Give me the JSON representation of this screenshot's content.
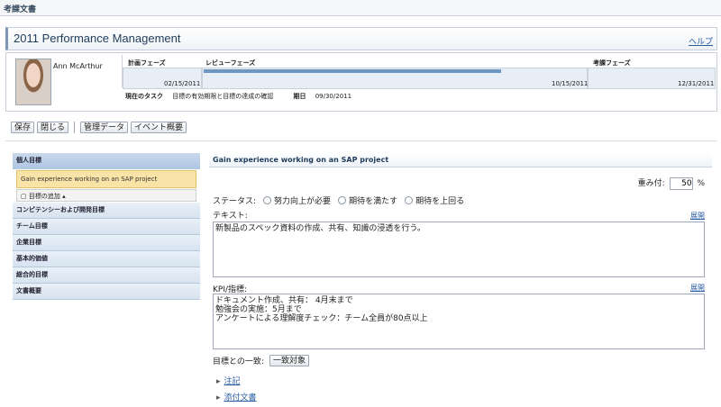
{
  "topbar": {
    "title": "考課文書"
  },
  "header": {
    "title": "2011 Performance Management",
    "help": "ヘルプ"
  },
  "profile": {
    "name": "Ann McArthur"
  },
  "phases": [
    {
      "label": "計画フェーズ",
      "date": "02/15/2011"
    },
    {
      "label": "レビューフェーズ",
      "date": "10/15/2011"
    },
    {
      "label": "考課フェーズ",
      "date": "12/31/2011"
    }
  ],
  "task": {
    "label": "現在のタスク",
    "value": "目標の有効期限と目標の達成の確認",
    "due_label": "期日",
    "due_value": "09/30/2011"
  },
  "toolbar": {
    "save": "保存",
    "close": "閉じる",
    "admin_data": "管理データ",
    "event_summary": "イベント概要"
  },
  "sidebar": {
    "items": [
      {
        "label": "個人目標"
      },
      {
        "label": "コンピテンシーおよび開発目標"
      },
      {
        "label": "チーム目標"
      },
      {
        "label": "企業目標"
      },
      {
        "label": "基本的価値"
      },
      {
        "label": "総合的目標"
      },
      {
        "label": "文書概要"
      }
    ],
    "active_goal": "Gain experience working on an SAP project",
    "add_goal": "目標の追加"
  },
  "main": {
    "heading": "Gain experience working on an SAP project",
    "weight_label": "重み付:",
    "weight_value": "50",
    "weight_unit": "%",
    "status_label": "ステータス:",
    "status_options": [
      "努力向上が必要",
      "期待を満たす",
      "期待を上回る"
    ],
    "text_label": "テキスト:",
    "expand": "展開",
    "text_value": "新製品のスペック資料の作成、共有、知識の浸透を行う。",
    "kpi_label": "KPI/指標:",
    "kpi_value": "ドキュメント作成、共有： 4月末まで\n勉強会の実施：5月まで\nアンケートによる理解度チェック：チーム全員が80点以上",
    "alignment_label": "目標との一致:",
    "alignment_button": "一致対象",
    "links": [
      "注記",
      "添付文書"
    ]
  }
}
